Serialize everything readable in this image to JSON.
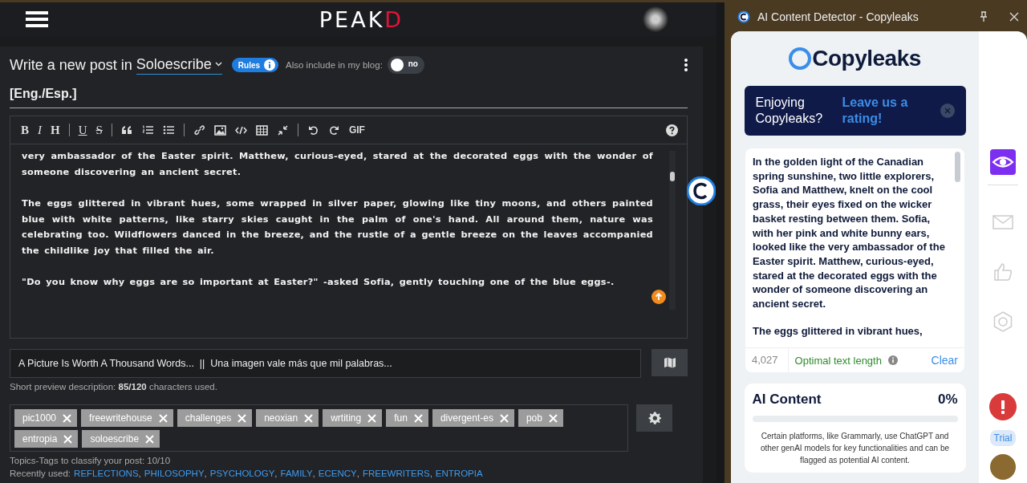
{
  "header": {
    "logo": "PEAK",
    "logo_accent": "D"
  },
  "composer": {
    "title_prefix": "Write a new post in",
    "community": "Soloescribe",
    "rules": "Rules",
    "blog_toggle": {
      "label": "Also include in my blog:",
      "on": false,
      "value": "no"
    },
    "post_title": "[Eng./Esp.]",
    "toolbar": [
      [
        {
          "kind": "bold",
          "label": "B"
        },
        {
          "kind": "italic",
          "label": "I"
        },
        {
          "kind": "heading",
          "label": "H"
        }
      ],
      [
        {
          "kind": "underline",
          "label": "U"
        },
        {
          "kind": "strike",
          "label": "S"
        }
      ],
      [
        {
          "kind": "quote"
        },
        {
          "kind": "ordered-list"
        },
        {
          "kind": "unordered-list"
        }
      ],
      [
        {
          "kind": "link"
        },
        {
          "kind": "image"
        },
        {
          "kind": "code"
        },
        {
          "kind": "table"
        },
        {
          "kind": "collapse"
        }
      ],
      [
        {
          "kind": "undo"
        },
        {
          "kind": "redo"
        },
        {
          "kind": "gif",
          "label": "GIF"
        }
      ]
    ],
    "body": [
      "very ambassador of the Easter spirit. Matthew, curious-eyed, stared at the decorated eggs with the wonder of someone discovering an ancient secret.",
      "The eggs glittered in vibrant hues, some wrapped in silver paper, glowing like tiny moons, and others painted blue with white patterns, like starry skies caught in the palm of one's hand. All around them, nature was celebrating too. Wildflowers danced in the breeze, and the rustle of a gentle breeze on the leaves accompanied the childlike joy that filled the air.",
      "\"Do you know why eggs are so important at Easter?\" -asked Sofia, gently touching one of the blue eggs-."
    ],
    "description": "A Picture Is Worth A Thousand Words...  ||  Una imagen vale más que mil palabras...",
    "description_hint": "Short preview description: **85/120** characters used.",
    "tags": [
      "pic1000",
      "freewritehouse",
      "challenges",
      "neoxian",
      "wrtiting",
      "fun",
      "divergent-es",
      "pob",
      "entropia",
      "soloescribe"
    ],
    "tags_hint": "Topics-Tags to classify your post: 10/10",
    "recent_label": "Recently used:",
    "recent_separator": ",",
    "recent": [
      "REFLECTIONS",
      "PHILOSOPHY",
      "PSYCHOLOGY",
      "FAMILY",
      "ECENCY",
      "FREEWRITERS",
      "ENTROPIA"
    ]
  },
  "copyleaks": {
    "window_title": "AI Content Detector - Copyleaks",
    "logo": "Copyleaks",
    "banner": {
      "text": "Enjoying Copyleaks?",
      "link": "Leave us a rating!"
    },
    "text": [
      "In the golden light of the Canadian spring sunshine, two little explorers, Sofia and Matthew, knelt on the cool grass, their eyes fixed on the wicker basket resting between them. Sofia, with her pink and white bunny ears, looked like the very ambassador of the Easter spirit. Matthew, curious-eyed, stared at the decorated eggs with the wonder of someone discovering an ancient secret.",
      "The eggs glittered in vibrant hues,"
    ],
    "count": "4,027",
    "length_status": "Optimal text length",
    "clear": "Clear",
    "ai": {
      "title": "AI Content",
      "value": "0%",
      "level": 0,
      "note": "Certain platforms, like Grammarly, use ChatGPT and other genAI models for key functionalities and can be flagged as potential AI content."
    },
    "sidebar": [
      {
        "kind": "eye",
        "selected": true
      },
      {
        "kind": "mail",
        "selected": false
      },
      {
        "kind": "like",
        "selected": false
      },
      {
        "kind": "hexagon",
        "selected": false
      }
    ],
    "trial": "Trial"
  }
}
